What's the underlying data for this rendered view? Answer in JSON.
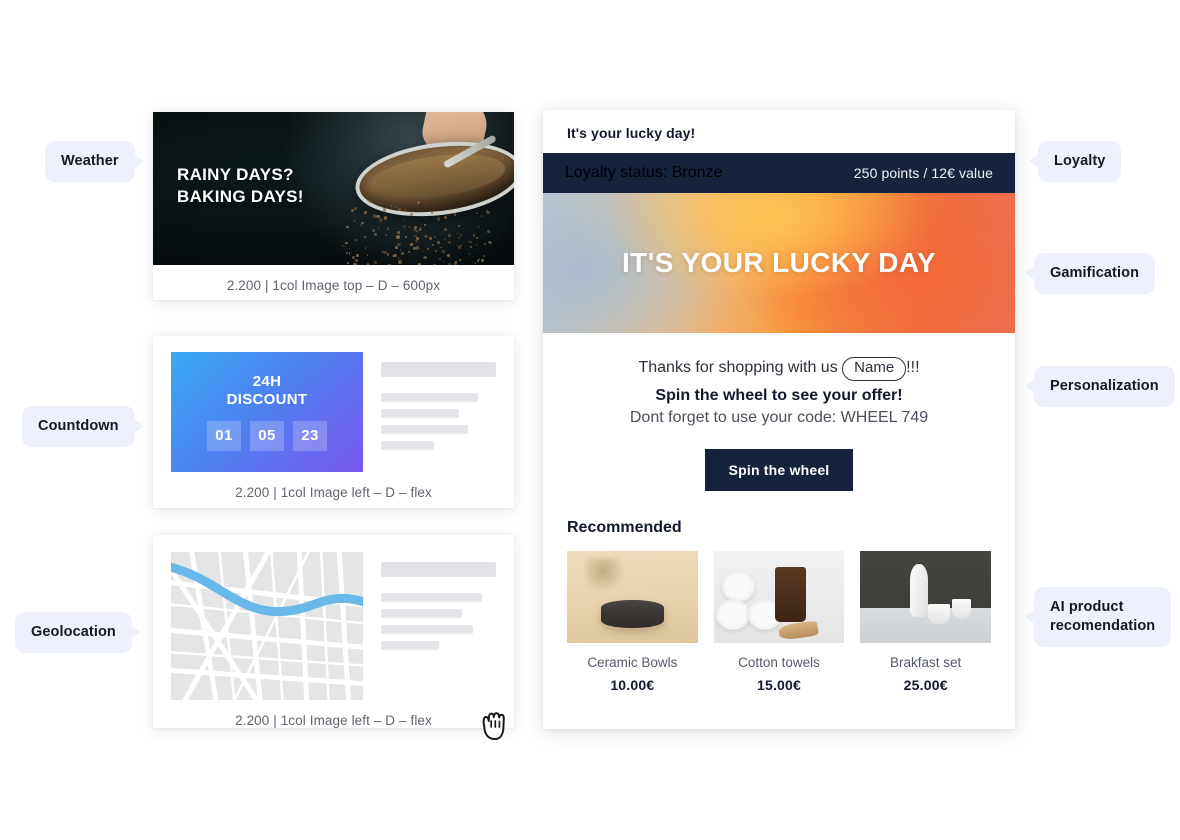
{
  "left_badges": [
    {
      "label": "Weather"
    },
    {
      "label": "Countdown"
    },
    {
      "label": "Geolocation"
    }
  ],
  "right_badges": [
    {
      "label": "Loyalty"
    },
    {
      "label": "Gamification"
    },
    {
      "label": "Personalization"
    },
    {
      "label": "AI product\nrecomendation"
    }
  ],
  "blocks": {
    "weather": {
      "hero_text": "RAINY DAYS?\nBAKING DAYS!",
      "caption": "2.200 | 1col Image top – D – 600px"
    },
    "countdown": {
      "title": "24H\nDISCOUNT",
      "digits": [
        "01",
        "05",
        "23"
      ],
      "caption": "2.200 | 1col Image left – D – flex"
    },
    "geolocation": {
      "caption": "2.200 | 1col Image left – D – flex"
    }
  },
  "preview": {
    "subject": "It's your lucky day!",
    "loyalty": {
      "status": "Loyalty status: Bronze",
      "points": "250 points / 12€ value"
    },
    "banner_title": "IT'S YOUR LUCKY DAY",
    "offer": {
      "line1_before": "Thanks for shopping with us",
      "name_token": "Name",
      "line1_after": "!!!",
      "line2": "Spin the wheel to see your offer!",
      "line3": "Dont forget to use your code: WHEEL 749"
    },
    "spin_button": "Spin the wheel",
    "recommended_title": "Recommended",
    "products": [
      {
        "name": "Ceramic Bowls",
        "price": "10.00€"
      },
      {
        "name": "Cotton towels",
        "price": "15.00€"
      },
      {
        "name": "Brakfast set",
        "price": "25.00€"
      }
    ]
  },
  "colors": {
    "badge_bg": "#eef0fb",
    "navy": "#17223e",
    "countdown_start": "#39a9f4",
    "countdown_end": "#7a58ef",
    "map_water": "#68b8e8"
  },
  "cursor": {
    "icon": "grab-hand-cursor"
  }
}
